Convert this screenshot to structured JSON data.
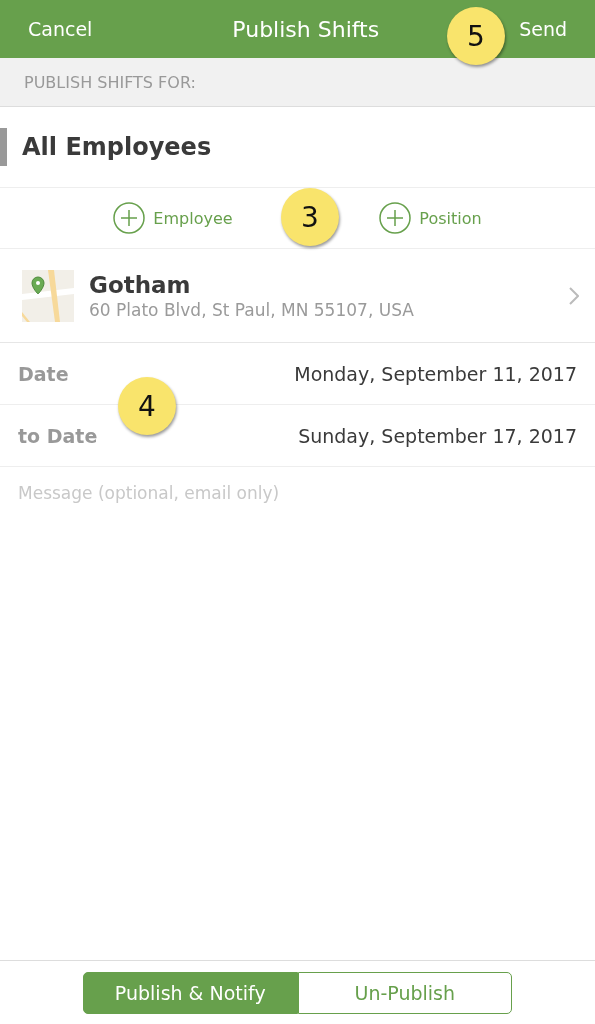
{
  "nav_bar": {
    "cancel": "Cancel",
    "title": "Publish Shifts",
    "send": "Send"
  },
  "section_header": "PUBLISH SHIFTS FOR:",
  "audience": "All Employees",
  "add_buttons": [
    {
      "label": "Employee"
    },
    {
      "label": "Position"
    }
  ],
  "location": {
    "name": "Gotham",
    "address": "60 Plato Blvd, St Paul, MN 55107, USA"
  },
  "dates": [
    {
      "label": "Date",
      "value": "Monday, September 11, 2017"
    },
    {
      "label": "to Date",
      "value": "Sunday, September 17, 2017"
    }
  ],
  "message": {
    "placeholder": "Message (optional, email only)"
  },
  "segments": [
    {
      "label": "Publish & Notify",
      "selected": true
    },
    {
      "label": "Un-Publish",
      "selected": false
    }
  ],
  "callouts": [
    {
      "number": "5"
    },
    {
      "number": "3"
    },
    {
      "number": "4"
    }
  ]
}
